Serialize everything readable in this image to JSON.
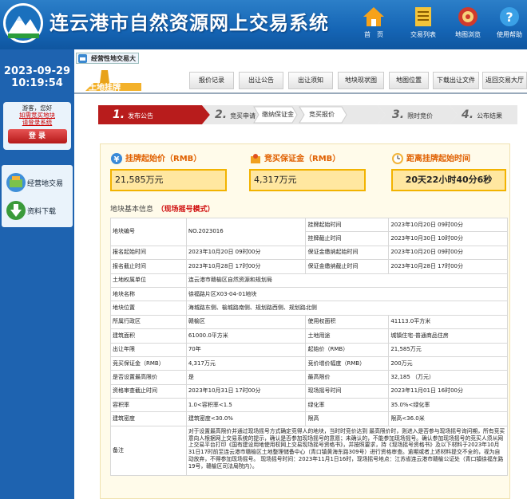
{
  "header": {
    "title": "连云港市自然资源网上交易系统",
    "buttons": [
      {
        "label": "首　页",
        "icon": "home-icon"
      },
      {
        "label": "交易列表",
        "icon": "list-icon"
      },
      {
        "label": "地图浏览",
        "icon": "map-icon"
      },
      {
        "label": "使用帮助",
        "icon": "help-icon"
      }
    ]
  },
  "sidebar": {
    "date": "2023-09-29",
    "time": "10:19:54",
    "greeting_1": "游客，您好",
    "greeting_2": "如需竞买地块",
    "greeting_3": "请登录系统",
    "login": "登 录",
    "menu": [
      {
        "label": "经营地交易",
        "icon": "parcel-icon"
      },
      {
        "label": "资料下载",
        "icon": "download-icon"
      }
    ]
  },
  "tab": {
    "label": "经营性地交易大"
  },
  "toolbar": {
    "brand": "土地挂牌",
    "buttons": [
      "报价记录",
      "出让公告",
      "出让须知",
      "地块现状图",
      "地图位置",
      "下载出让文件",
      "返回交易大厅"
    ]
  },
  "steps": [
    {
      "n": "1.",
      "label": "发布公告"
    },
    {
      "n": "2.",
      "label": "竞买申请"
    },
    {
      "n": "",
      "label": "缴纳保证金"
    },
    {
      "n": "",
      "label": "竞买报价"
    },
    {
      "n": "3.",
      "label": "限时竞价"
    },
    {
      "n": "4.",
      "label": "公布结果"
    }
  ],
  "cards": {
    "start_title": "挂牌起始价（RMB）",
    "start_value": "21,585万元",
    "deposit_title": "竞买保证金（RMB）",
    "deposit_value": "4,317万元",
    "countdown_title": "距离挂牌起始时间",
    "countdown_value": "20天22小时40分6秒"
  },
  "section": {
    "title": "地块基本信息",
    "mode": "（现场摇号模式）"
  },
  "rows": [
    [
      "地块编号",
      "NO.2023016",
      "挂牌起始时间",
      "2023年10月20日 09时00分"
    ],
    [
      "",
      "",
      "挂牌截止时间",
      "2023年10月30日 10时00分"
    ],
    [
      "报名起始时间",
      "2023年10月20日 09时00分",
      "保证金缴纳起始时间",
      "2023年10月20日 09时00分"
    ],
    [
      "报名截止时间",
      "2023年10月28日 17时00分",
      "保证金缴纳截止时间",
      "2023年10月28日 17时00分"
    ],
    [
      "土地权属单位",
      "连云港市赣榆区自然资源和规划局",
      "",
      ""
    ],
    [
      "地块名称",
      "徐福路片区X03-04-01地块",
      "",
      ""
    ],
    [
      "地块位置",
      "海城路东侧、榆城路南侧、规划路西侧、规划路北侧",
      "",
      ""
    ],
    [
      "所属行政区",
      "赣榆区",
      "使用权面积",
      "41113.0平方米"
    ],
    [
      "建筑面积",
      "61000.0平方米",
      "土地用途",
      "城镇住宅-普通商品住房"
    ],
    [
      "出让年限",
      "70年",
      "起始价（RMB）",
      "21,585万元"
    ],
    [
      "竞买保证金（RMB）",
      "4,317万元",
      "竞价增价幅度（RMB）",
      "200万元"
    ],
    [
      "是否设置最高限价",
      "是",
      "最高限价",
      "32,185 （万元）"
    ],
    [
      "资格审查截止时间",
      "2023年10月31日 17时00分",
      "现场摇号时间",
      "2023年11月01日 16时00分"
    ],
    [
      "容积率",
      "1.0<容积率<1.5",
      "绿化率",
      "35.0%<绿化率"
    ],
    [
      "建筑密度",
      "建筑密度<30.0%",
      "限高",
      "限高<36.0米"
    ]
  ],
  "note": {
    "label": "备注",
    "text": "对于设置最高限价并通过现场摇号方式确定竞得人的地块，当时时竞价达到 最高限价时，则进入是否参与现场摇号询问期，所有竞买意向人根据网上交易系统的提示，确认是否参加现场摇号的意愿；未确认的，不能参加现场摇号。确认参加现场摇号的竞买人须从网上交易平台打印《国有建设用地使用权网上交易现场摇号资格书》，并按照要求，持《现场摇号资格书》及以下材料于2023年10月31日17时前至连云港市赣榆区土地整理储备中心（青口镇黄海东路309号）进行资格审查。逾期或者上述材料提交不全的，视为自动放弃，不得参加现场摇号。 现场摇号时间：2023年11月1日16时，现场摇号地点：江苏省连云港市赣榆公证处（青口镇徐福东路19号，赣榆区司法局院内）。"
  }
}
